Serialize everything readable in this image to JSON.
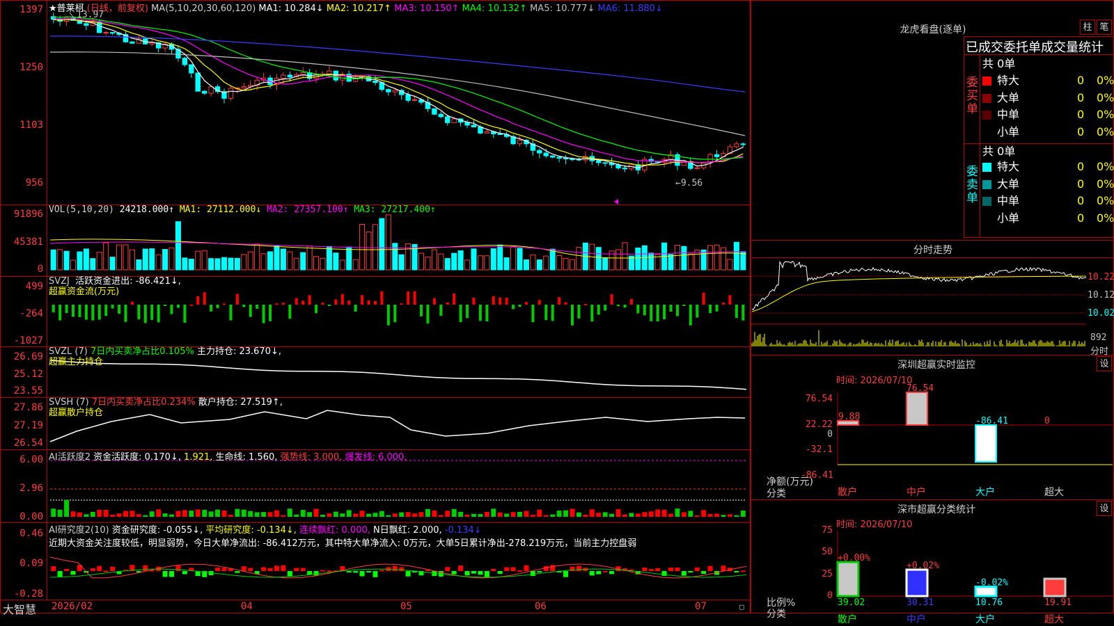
{
  "app": {
    "brand": "大智慧"
  },
  "kline": {
    "title": {
      "stock": "★普莱柯",
      "mode": "(日线，前复权)",
      "ma_label": "MA(5,10,20,30,60,120)",
      "ma1": "MA1: 10.284↓",
      "ma2": "MA2: 10.217↑",
      "ma3": "MA3: 10.150↑",
      "ma4": "MA4: 10.132↑",
      "ma5": "MA5: 10.777↓",
      "ma6": "MA6: 11.880↓"
    },
    "yticks": [
      "1397",
      "1250",
      "1103",
      "956"
    ],
    "high_label": "13.97",
    "low_label": "←9.56",
    "colors": {
      "ma1": "#ffffff",
      "ma2": "#ffff00",
      "ma3": "#ff00ff",
      "ma4": "#00ff00",
      "ma5": "#c0c0c0",
      "ma6": "#3c3cff"
    }
  },
  "vol": {
    "title": {
      "name": "VOL(5,10,20)",
      "val": "24218.000↑",
      "ma1": "MA1: 27112.000↓",
      "ma2": "MA2: 27357.100↑",
      "ma3": "MA3: 27217.400↑"
    },
    "yticks": [
      "91896",
      "45381",
      "0"
    ]
  },
  "svzj": {
    "title": {
      "name": "SVZJ",
      "label": "活跃资金进出: -86.421↓,",
      "sub": "超赢资金流(万元)"
    },
    "yticks": [
      "499",
      "-264",
      "-1027"
    ]
  },
  "svzl": {
    "title": {
      "name": "SVZL (7)",
      "ratio": "7日内买卖净占比0.105%",
      "hold": "主力持仓: 23.670↓,",
      "sub": "超赢主力持仓"
    },
    "yticks": [
      "26.69",
      "25.12",
      "23.55"
    ]
  },
  "svsh": {
    "title": {
      "name": "SVSH (7)",
      "ratio": "7日内买卖净占比0.234%",
      "hold": "散户持仓: 27.519↑,",
      "sub": "超赢散户持仓"
    },
    "yticks": [
      "27.86",
      "27.19",
      "26.54"
    ]
  },
  "ai_active": {
    "title": {
      "name": "AI活跃度2",
      "label": "资金活跃度: 0.170↓,",
      "v2": "1.921,",
      "life": "生命线: 1.560,",
      "strong": "强势线: 3.000,",
      "burst": "爆发线: 6.000,"
    },
    "yticks": [
      "6.00",
      "2.96",
      "0.00"
    ]
  },
  "ai_research": {
    "title": {
      "name": "AI研究度2(10)",
      "label": "资金研究度: -0.055↓,",
      "avg": "平均研究度: -0.134↓,",
      "red": "连续飘红: 0.000,",
      "nred": "N日飘红: 2.000,",
      "last": "-0.134↓"
    },
    "desc": "近期大资金关注度较低，明显弱势，今日大单净流出: -86.412万元，其中特大单净流入: 0万元，大单5日累计净出-278.219万元，当前主力控盘弱",
    "yticks": [
      "0.46",
      "0.09",
      "-0.28"
    ]
  },
  "xaxis": {
    "labels": [
      "2026/02",
      "04",
      "05",
      "06",
      "07"
    ]
  },
  "lhb": {
    "title": "龙虎看盘(逐单)",
    "btn_bar": "柱",
    "btn_pen": "笔",
    "subtitle": "已成交委托单成交量统计",
    "buy": {
      "side": "委买单",
      "total": "共 0单",
      "rows": [
        {
          "name": "特大",
          "count": "0",
          "pct": "0%",
          "color": "#ff0000"
        },
        {
          "name": "大单",
          "count": "0",
          "pct": "0%",
          "color": "#8b0000"
        },
        {
          "name": "中单",
          "count": "0",
          "pct": "0%",
          "color": "#5a0000"
        },
        {
          "name": "小单",
          "count": "0",
          "pct": "0%",
          "color": "#000000"
        }
      ]
    },
    "sell": {
      "side": "委卖单",
      "total": "共 0单",
      "rows": [
        {
          "name": "特大",
          "count": "0",
          "pct": "0%",
          "color": "#00ffff"
        },
        {
          "name": "大单",
          "count": "0",
          "pct": "0%",
          "color": "#009999"
        },
        {
          "name": "中单",
          "count": "0",
          "pct": "0%",
          "color": "#006666"
        },
        {
          "name": "小单",
          "count": "0",
          "pct": "0%",
          "color": "#000000"
        }
      ]
    }
  },
  "intraday": {
    "title": "分时走势",
    "price_ticks": [
      "10.22",
      "10.12",
      "10.02"
    ],
    "vol_tick": "892",
    "vol_label": "分时"
  },
  "sz_monitor": {
    "title": "深圳超赢实时监控",
    "settings_btn": "设",
    "time": "时间: 2026/07/10",
    "yticks": [
      "76.54",
      "22.22",
      "0",
      "-32.1",
      "-86.41"
    ],
    "unit": "净额(万元)",
    "cat_label": "分类",
    "chart_data": {
      "type": "bar",
      "categories": [
        "散户",
        "中户",
        "大户",
        "超大"
      ],
      "values": [
        9.88,
        76.54,
        -86.41,
        0
      ],
      "value_labels": [
        "9.88",
        "76.54",
        "-86.41",
        "0"
      ],
      "ylim": [
        -86.41,
        76.54
      ]
    }
  },
  "sz_classify": {
    "title": "深市超赢分类统计",
    "settings_btn": "设",
    "time": "时间: 2026/07/10",
    "yticks": [
      "75",
      "50",
      "25",
      "0"
    ],
    "unit": "比例%",
    "cat_label": "分类",
    "chart_data": {
      "type": "bar",
      "categories": [
        "散户",
        "中户",
        "大户",
        "超大"
      ],
      "values": [
        39.02,
        30.31,
        10.76,
        19.91
      ],
      "value_labels": [
        "39.02",
        "30.31",
        "10.76",
        "19.91"
      ],
      "changes": [
        "+0.00%",
        "+0.02%",
        "-0.02%",
        ""
      ],
      "ylim": [
        0,
        75
      ]
    }
  }
}
